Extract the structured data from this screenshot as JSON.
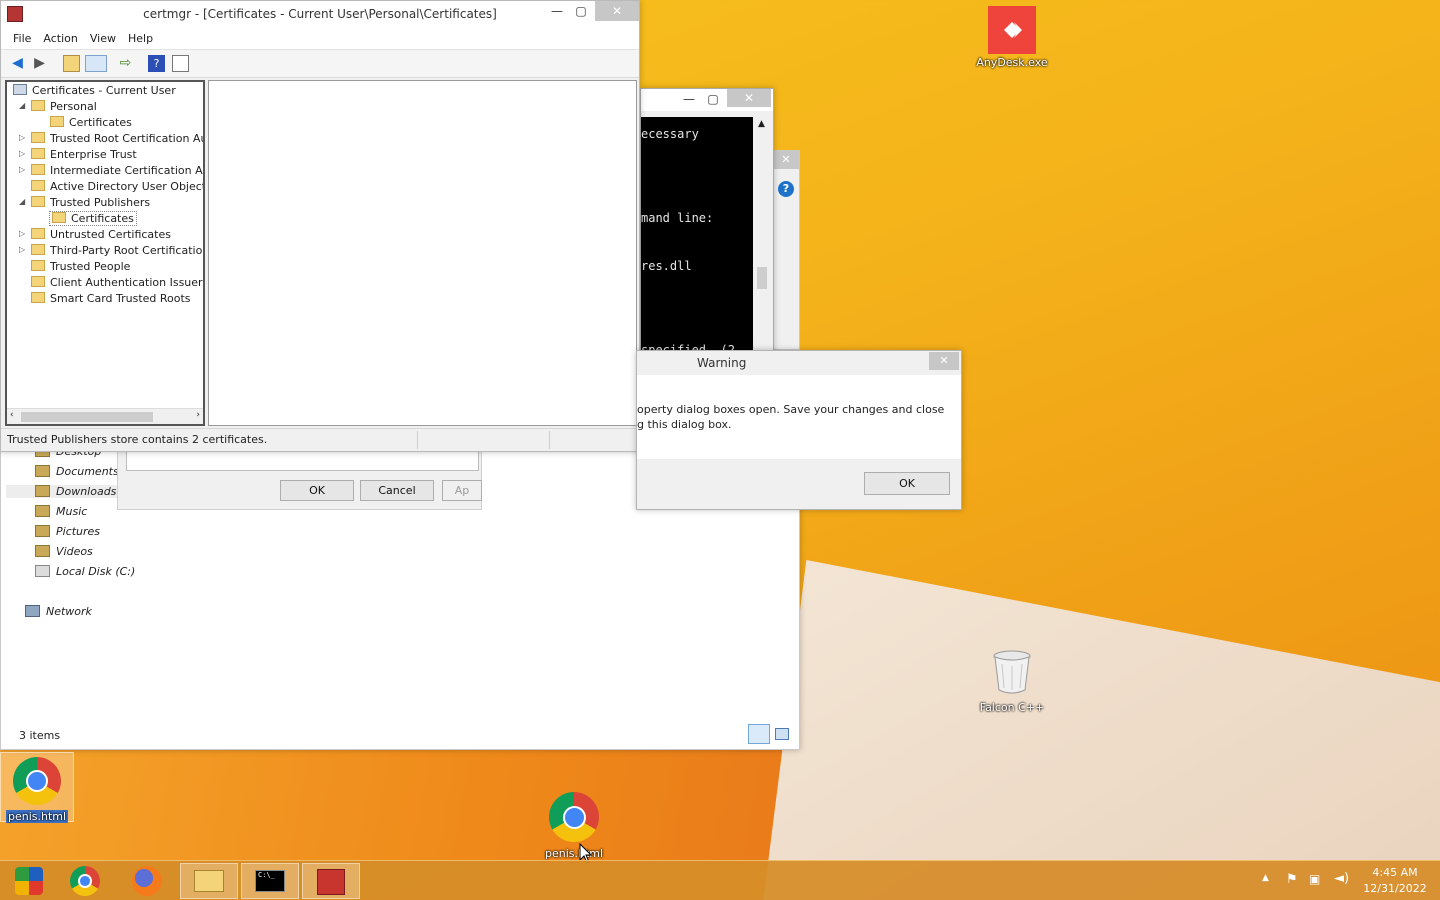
{
  "desktop": {
    "anydesk_label": "AnyDesk.exe",
    "recycle_label": "Falcon C++",
    "chrome_shortcut_label": "penis.html",
    "chrome_shortcut2_label": "penis.html"
  },
  "explorer": {
    "nav": [
      "Desktop",
      "Documents",
      "Downloads",
      "Music",
      "Pictures",
      "Videos",
      "Local Disk (C:)",
      "Network"
    ],
    "status": "3 items",
    "ok": "OK",
    "cancel": "Cancel",
    "apply": "Ap"
  },
  "certmgr": {
    "title": "certmgr - [Certificates - Current User\\Personal\\Certificates]",
    "menu": [
      "File",
      "Action",
      "View",
      "Help"
    ],
    "tree": {
      "root": "Certificates - Current User",
      "personal": "Personal",
      "personal_child": "Certificates",
      "trusted_root": "Trusted Root Certification Aut",
      "enterprise": "Enterprise Trust",
      "intermediate": "Intermediate Certification Au",
      "ad_user": "Active Directory User Object",
      "trusted_publishers": "Trusted Publishers",
      "publishers_child": "Certificates",
      "untrusted": "Untrusted Certificates",
      "third_party": "Third-Party Root Certification",
      "trusted_people": "Trusted People",
      "client_auth": "Client Authentication Issuers",
      "smart_card": "Smart Card Trusted Roots"
    },
    "status": "Trusted Publishers store contains 2 certificates."
  },
  "console": {
    "lines": [
      "ecessary",
      "mand line:",
      "res.dll",
      "specified. (2"
    ]
  },
  "warning": {
    "title": "Warning",
    "line1": "operty dialog boxes open. Save your changes and close",
    "line2": "g this dialog box.",
    "ok": "OK"
  },
  "taskbar": {
    "time": "4:45 AM",
    "date": "12/31/2022"
  },
  "colors": {
    "anydesk": "#ef443b",
    "taskbar": "#d68c28"
  }
}
